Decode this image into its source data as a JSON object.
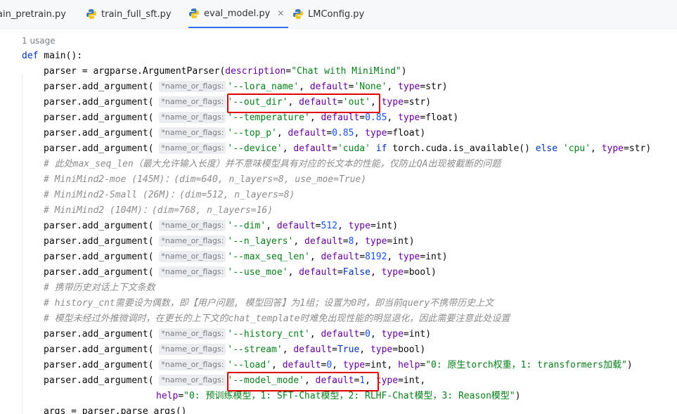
{
  "tabs": [
    {
      "label": "ain_pretrain.py",
      "active": false
    },
    {
      "label": "train_full_sft.py",
      "active": false
    },
    {
      "label": "eval_model.py",
      "active": true
    },
    {
      "label": "LMConfig.py",
      "active": false
    }
  ],
  "editor": {
    "usage_hint": "1 usage",
    "hint_label": "*name_or_flags:",
    "lines": {
      "def_kw": "def",
      "def_name": " main():",
      "parser_a": "parser = argparse.ArgumentParser(",
      "parser_param": "description",
      "parser_eq": "=",
      "parser_str": "\"Chat with MiniMind\"",
      "parser_end": ")",
      "aa": "parser.add_argument( ",
      "l1_flag": "'--lora_name'",
      "l1_rest_a": ", ",
      "l1_p1": "default",
      "l1_eq1": "=",
      "l1_v1": "'None'",
      "l1_sep": ", ",
      "l1_p2": "type",
      "l1_v2": "=str)",
      "l2_flag": "'--out_dir'",
      "l2_sep1": ", ",
      "l2_p1": "default",
      "l2_eq1": "=",
      "l2_v1": "'out'",
      "l2_sep2": ", ",
      "l2_p2": "type",
      "l2_v2": "=str)",
      "l3_flag": "'--temperature'",
      "l3_p1": "default",
      "l3_v1": "0.85",
      "l3_p2": "type",
      "l3_v2": "=float)",
      "l4_flag": "'--top_p'",
      "l4_p1": "default",
      "l4_v1": "0.85",
      "l4_p2": "type",
      "l4_v2": "=float)",
      "l5_flag": "'--device'",
      "l5_p1": "default",
      "l5_v1": "'cuda'",
      "l5_if": " if ",
      "l5_mid": "torch.cuda.is_available() ",
      "l5_else": "else ",
      "l5_v2": "'cpu'",
      "l5_p2": "type",
      "l5_v3": "=str)",
      "c1": "# 此处max_seq_len（最大允许输入长度）并不意味模型具有对应的长文本的性能，仅防止QA出现被截断的问题",
      "c2": "# MiniMind2-moe (145M)：(dim=640, n_layers=8, use_moe=True)",
      "c3": "# MiniMind2-Small (26M)：(dim=512, n_layers=8)",
      "c4": "# MiniMind2 (104M)：(dim=768, n_layers=16)",
      "l6_flag": "'--dim'",
      "l6_p1": "default",
      "l6_v1": "512",
      "l6_p2": "type",
      "l6_v2": "=int)",
      "l7_flag": "'--n_layers'",
      "l7_p1": "default",
      "l7_v1": "8",
      "l7_p2": "type",
      "l7_v2": "=int)",
      "l8_flag": "'--max_seq_len'",
      "l8_p1": "default",
      "l8_v1": "8192",
      "l8_p2": "type",
      "l8_v2": "=int)",
      "l9_flag": "'--use_moe'",
      "l9_p1": "default",
      "l9_v1": "False",
      "l9_p2": "type",
      "l9_v2": "=bool)",
      "c5": "# 携带历史对话上下文条数",
      "c6": "# history_cnt需要设为偶数，即【用户问题, 模型回答】为1组；设置为0时，即当前query不携带历史上文",
      "c7": "# 模型未经过外推微调时，在更长的上下文的chat_template时难免出现性能的明显退化，因此需要注意此处设置",
      "l10_flag": "'--history_cnt'",
      "l10_p1": "default",
      "l10_v1": "0",
      "l10_p2": "type",
      "l10_v2": "=int)",
      "l11_flag": "'--stream'",
      "l11_p1": "default",
      "l11_v1": "True",
      "l11_p2": "type",
      "l11_v2": "=bool)",
      "l12_flag": "'--load'",
      "l12_p1": "default",
      "l12_v1": "0",
      "l12_p2": "type",
      "l12_v2": "=int, ",
      "l12_p3": "help",
      "l12_eq3": "=",
      "l12_v3": "\"0: 原生torch权重，1: transformers加载\"",
      "l12_end": ")",
      "l13_flag": "'--model_mode'",
      "l13_p1": "default",
      "l13_v1": "1",
      "l13_p2": "type",
      "l13_v2": "=int,",
      "l14_p": "help",
      "l14_eq": "=",
      "l14_v": "\"0: 预训练模型，1: SFT-Chat模型，2: RLHF-Chat模型，3: Reason模型\"",
      "l14_end": ")",
      "l15": "args = parser.parse_args()"
    }
  },
  "colors": {
    "keyword": "#0033b3",
    "string": "#067d17",
    "number": "#1750eb",
    "param": "#660099",
    "comment": "#8c8c8c",
    "highlight_box": "#e00000",
    "active_tab": "#3574f0"
  }
}
